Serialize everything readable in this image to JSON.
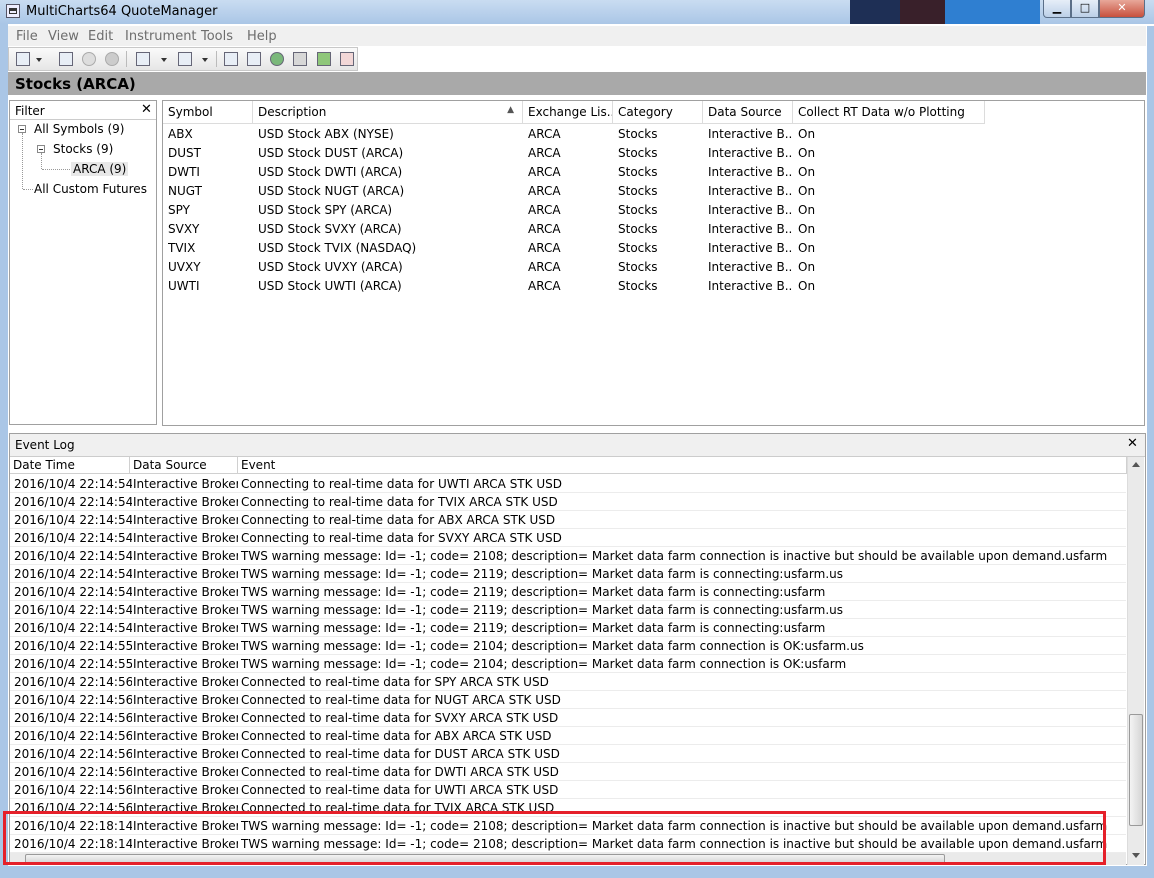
{
  "window": {
    "title": "MultiCharts64 QuoteManager",
    "min": "0",
    "max": "1",
    "close": "r"
  },
  "menu": [
    "File",
    "View",
    "Edit",
    "Instrument",
    "Tools",
    "Help"
  ],
  "section_title": "Stocks (ARCA)",
  "filter": {
    "title": "Filter",
    "close": "✕",
    "tree": [
      {
        "label": "All Symbols (9)"
      },
      {
        "label": "Stocks (9)"
      },
      {
        "label": "ARCA (9)"
      },
      {
        "label": "All Custom Futures"
      }
    ]
  },
  "symbols": {
    "columns": [
      "Symbol",
      "Description",
      "Exchange Lis...",
      "Category",
      "Data Source",
      "Collect RT Data w/o Plotting"
    ],
    "rows": [
      [
        "ABX",
        "USD Stock ABX (NYSE)",
        "ARCA",
        "Stocks",
        "Interactive B...",
        "On"
      ],
      [
        "DUST",
        "USD Stock DUST (ARCA)",
        "ARCA",
        "Stocks",
        "Interactive B...",
        "On"
      ],
      [
        "DWTI",
        "USD Stock DWTI (ARCA)",
        "ARCA",
        "Stocks",
        "Interactive B...",
        "On"
      ],
      [
        "NUGT",
        "USD Stock NUGT (ARCA)",
        "ARCA",
        "Stocks",
        "Interactive B...",
        "On"
      ],
      [
        "SPY",
        "USD Stock SPY (ARCA)",
        "ARCA",
        "Stocks",
        "Interactive B...",
        "On"
      ],
      [
        "SVXY",
        "USD Stock SVXY (ARCA)",
        "ARCA",
        "Stocks",
        "Interactive B...",
        "On"
      ],
      [
        "TVIX",
        "USD Stock TVIX (NASDAQ)",
        "ARCA",
        "Stocks",
        "Interactive B...",
        "On"
      ],
      [
        "UVXY",
        "USD Stock UVXY (ARCA)",
        "ARCA",
        "Stocks",
        "Interactive B...",
        "On"
      ],
      [
        "UWTI",
        "USD Stock UWTI (ARCA)",
        "ARCA",
        "Stocks",
        "Interactive B...",
        "On"
      ]
    ]
  },
  "event_log": {
    "title": "Event Log",
    "close": "✕",
    "columns": [
      "Date Time",
      "Data Source",
      "Event"
    ],
    "rows": [
      [
        "2016/10/4  22:14:54",
        "Interactive Broker",
        "Connecting to real-time data for UWTI ARCA STK USD"
      ],
      [
        "2016/10/4  22:14:54",
        "Interactive Broker",
        "Connecting to real-time data for TVIX ARCA STK USD"
      ],
      [
        "2016/10/4  22:14:54",
        "Interactive Broker",
        "Connecting to real-time data for ABX ARCA STK USD"
      ],
      [
        "2016/10/4  22:14:54",
        "Interactive Broker",
        "Connecting to real-time data for SVXY ARCA STK USD"
      ],
      [
        "2016/10/4  22:14:54",
        "Interactive Broker",
        "TWS warning message: Id= -1; code= 2108; description= Market data farm connection is inactive but should be available upon demand.usfarm"
      ],
      [
        "2016/10/4  22:14:54",
        "Interactive Broker",
        "TWS warning message: Id= -1; code= 2119; description= Market data farm is connecting:usfarm.us"
      ],
      [
        "2016/10/4  22:14:54",
        "Interactive Broker",
        "TWS warning message: Id= -1; code= 2119; description= Market data farm is connecting:usfarm"
      ],
      [
        "2016/10/4  22:14:54",
        "Interactive Broker",
        "TWS warning message: Id= -1; code= 2119; description= Market data farm is connecting:usfarm.us"
      ],
      [
        "2016/10/4  22:14:54",
        "Interactive Broker",
        "TWS warning message: Id= -1; code= 2119; description= Market data farm is connecting:usfarm"
      ],
      [
        "2016/10/4  22:14:55",
        "Interactive Broker",
        "TWS warning message: Id= -1; code= 2104; description= Market data farm connection is OK:usfarm.us"
      ],
      [
        "2016/10/4  22:14:55",
        "Interactive Broker",
        "TWS warning message: Id= -1; code= 2104; description= Market data farm connection is OK:usfarm"
      ],
      [
        "2016/10/4  22:14:56",
        "Interactive Broker",
        "Connected to real-time data for SPY ARCA STK USD"
      ],
      [
        "2016/10/4  22:14:56",
        "Interactive Broker",
        "Connected to real-time data for NUGT ARCA STK USD"
      ],
      [
        "2016/10/4  22:14:56",
        "Interactive Broker",
        "Connected to real-time data for SVXY ARCA STK USD"
      ],
      [
        "2016/10/4  22:14:56",
        "Interactive Broker",
        "Connected to real-time data for ABX ARCA STK USD"
      ],
      [
        "2016/10/4  22:14:56",
        "Interactive Broker",
        "Connected to real-time data for DUST ARCA STK USD"
      ],
      [
        "2016/10/4  22:14:56",
        "Interactive Broker",
        "Connected to real-time data for DWTI ARCA STK USD"
      ],
      [
        "2016/10/4  22:14:56",
        "Interactive Broker",
        "Connected to real-time data for UWTI ARCA STK USD"
      ],
      [
        "2016/10/4  22:14:56",
        "Interactive Broker",
        "Connected to real-time data for TVIX ARCA STK USD"
      ],
      [
        "2016/10/4  22:18:14",
        "Interactive Broker",
        "TWS warning message: Id= -1; code= 2108; description= Market data farm connection is inactive but should be available upon demand.usfarm"
      ],
      [
        "2016/10/4  22:18:14",
        "Interactive Broker",
        "TWS warning message: Id= -1; code= 2108; description= Market data farm connection is inactive but should be available upon demand.usfarm"
      ]
    ]
  },
  "colors": {
    "highlight": "#e5202a",
    "header_gray": "#a9a9a9",
    "title_blue": "#aac6e6"
  },
  "icons": [
    "app-icon",
    "new-symbol-icon",
    "edit-symbol-icon",
    "settings-icon",
    "delete-icon",
    "import-icon",
    "export-icon",
    "calendar-icon",
    "monitor-icon",
    "chart-icon",
    "exchange-icon",
    "book-icon",
    "session-icon"
  ]
}
